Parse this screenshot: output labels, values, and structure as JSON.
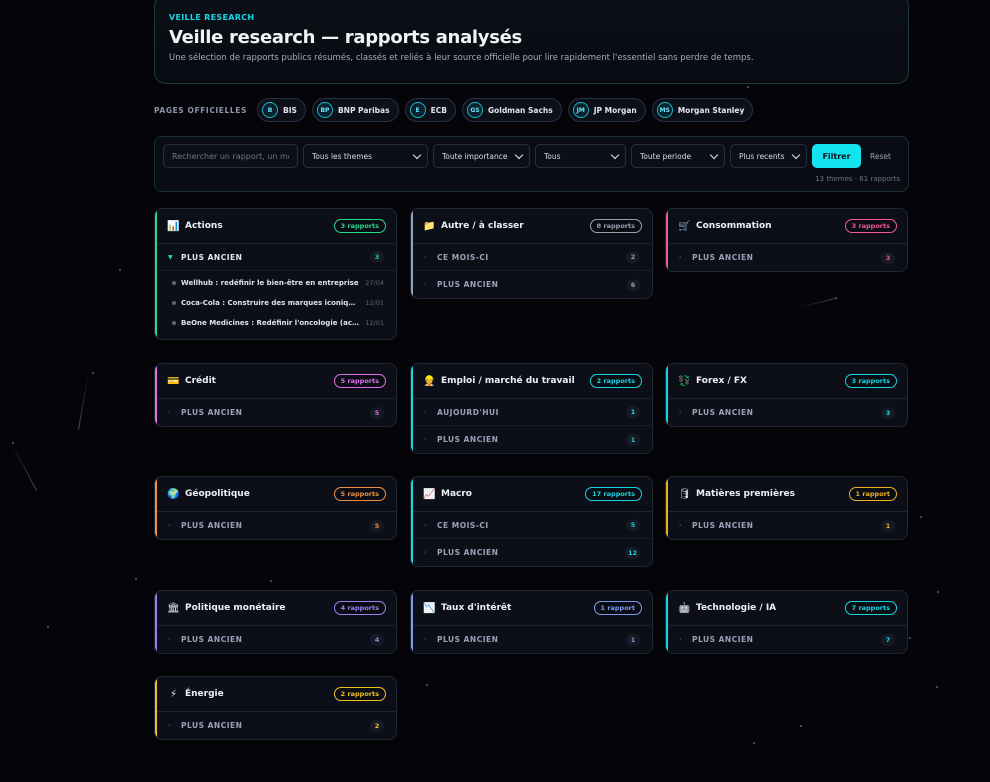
{
  "header": {
    "eyebrow": "VEILLE RESEARCH",
    "title": "Veille research — rapports analysés",
    "subtitle": "Une sélection de rapports publics résumés, classés et reliés à leur source officielle pour lire rapidement l'essentiel sans perdre de temps."
  },
  "pages": {
    "label": "PAGES OFFICIELLES",
    "items": [
      {
        "badge": "B",
        "label": "BIS"
      },
      {
        "badge": "BP",
        "label": "BNP Paribas"
      },
      {
        "badge": "E",
        "label": "ECB"
      },
      {
        "badge": "GS",
        "label": "Goldman Sachs"
      },
      {
        "badge": "JM",
        "label": "JP Morgan"
      },
      {
        "badge": "MS",
        "label": "Morgan Stanley"
      }
    ]
  },
  "filters": {
    "search_placeholder": "Rechercher un rapport, un mot",
    "theme": "Tous les themes",
    "importance": "Toute importance",
    "type": "Tous",
    "period": "Toute periode",
    "sort": "Plus recents",
    "filter_label": "Filtrer",
    "reset_label": "Reset",
    "meta": "13 themes · 61 rapports"
  },
  "cards": [
    {
      "title": "Actions",
      "icon": "bar-chart-icon",
      "badge": "3 rapports",
      "accent": "#22d88a",
      "sections": [
        {
          "label": "PLUS ANCIEN",
          "count": "3",
          "open": true,
          "items": [
            {
              "title": "Wellhub : redéfinir le bien-être en entreprise",
              "date": "27/04"
            },
            {
              "title": "Coca-Cola : Construire des marques iconiques...",
              "date": "12/01"
            },
            {
              "title": "BeOne Medicines : Redéfinir l'oncologie (acc...",
              "date": "12/01"
            }
          ]
        }
      ]
    },
    {
      "title": "Autre / à classer",
      "icon": "folder-icon",
      "badge": "8 rapports",
      "accent": "#9aa0b4",
      "sections": [
        {
          "label": "CE MOIS-CI",
          "count": "2"
        },
        {
          "label": "PLUS ANCIEN",
          "count": "6"
        }
      ]
    },
    {
      "title": "Consommation",
      "icon": "cart-icon",
      "badge": "3 rapports",
      "accent": "#f05a9a",
      "sections": [
        {
          "label": "PLUS ANCIEN",
          "count": "3"
        }
      ]
    },
    {
      "title": "Crédit",
      "icon": "card-icon",
      "badge": "5 rapports",
      "accent": "#e070e8",
      "sections": [
        {
          "label": "PLUS ANCIEN",
          "count": "5"
        }
      ]
    },
    {
      "title": "Emploi / marché du travail",
      "icon": "worker-icon",
      "badge": "2 rapports",
      "accent": "#16d6e4",
      "sections": [
        {
          "label": "AUJOURD'HUI",
          "count": "1"
        },
        {
          "label": "PLUS ANCIEN",
          "count": "1"
        }
      ]
    },
    {
      "title": "Forex / FX",
      "icon": "exchange-icon",
      "badge": "3 rapports",
      "accent": "#16d6e4",
      "sections": [
        {
          "label": "PLUS ANCIEN",
          "count": "3"
        }
      ]
    },
    {
      "title": "Géopolitique",
      "icon": "globe-icon",
      "badge": "5 rapports",
      "accent": "#f09040",
      "sections": [
        {
          "label": "PLUS ANCIEN",
          "count": "5"
        }
      ]
    },
    {
      "title": "Macro",
      "icon": "line-chart-icon",
      "badge": "17 rapports",
      "accent": "#16d6e4",
      "sections": [
        {
          "label": "CE MOIS-CI",
          "count": "5"
        },
        {
          "label": "PLUS ANCIEN",
          "count": "12"
        }
      ]
    },
    {
      "title": "Matières premières",
      "icon": "barrel-icon",
      "badge": "1 rapport",
      "accent": "#f0b020",
      "sections": [
        {
          "label": "PLUS ANCIEN",
          "count": "1"
        }
      ]
    },
    {
      "title": "Politique monétaire",
      "icon": "bank-icon",
      "badge": "4 rapports",
      "accent": "#9a80f0",
      "sections": [
        {
          "label": "PLUS ANCIEN",
          "count": "4"
        }
      ]
    },
    {
      "title": "Taux d'intérêt",
      "icon": "trend-down-icon",
      "badge": "1 rapport",
      "accent": "#7c9cf0",
      "sections": [
        {
          "label": "PLUS ANCIEN",
          "count": "1"
        }
      ]
    },
    {
      "title": "Technologie / IA",
      "icon": "robot-icon",
      "badge": "7 rapports",
      "accent": "#16d6e4",
      "sections": [
        {
          "label": "PLUS ANCIEN",
          "count": "7"
        }
      ]
    },
    {
      "title": "Énergie",
      "icon": "lightning-icon",
      "badge": "2 rapports",
      "accent": "#f0c020",
      "sections": [
        {
          "label": "PLUS ANCIEN",
          "count": "2"
        }
      ]
    }
  ]
}
